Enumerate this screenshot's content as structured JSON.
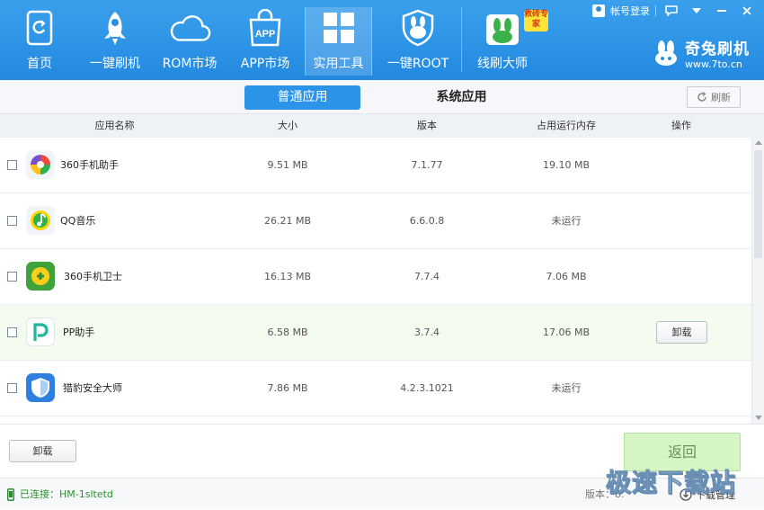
{
  "header": {
    "nav": [
      {
        "label": "首页",
        "icon": "home-icon"
      },
      {
        "label": "一键刷机",
        "icon": "rocket-icon"
      },
      {
        "label": "ROM市场",
        "icon": "cloud-icon"
      },
      {
        "label": "APP市场",
        "icon": "shopping-bag-icon",
        "icon_text": "APP"
      },
      {
        "label": "实用工具",
        "icon": "grid-icon"
      },
      {
        "label": "一键ROOT",
        "icon": "shield-rabbit-icon"
      },
      {
        "label": "线刷大师",
        "icon": "rabbit-master-icon"
      }
    ],
    "expert_badge": "救砖专家",
    "login_label": "帐号登录",
    "brand_name": "奇兔刷机",
    "brand_url": "www.7to.cn"
  },
  "tabs": [
    {
      "label": "普通应用",
      "active": true
    },
    {
      "label": "系统应用",
      "active": false
    }
  ],
  "refresh_label": "刷新",
  "table": {
    "columns": [
      "应用名称",
      "大小",
      "版本",
      "占用运行内存",
      "操作"
    ],
    "rows": [
      {
        "name": "360手机助手",
        "size": "9.51 MB",
        "version": "7.1.77",
        "memory": "19.10 MB",
        "action": "",
        "icon": "360-assistant-icon"
      },
      {
        "name": "QQ音乐",
        "size": "26.21 MB",
        "version": "6.6.0.8",
        "memory": "未运行",
        "action": "",
        "icon": "qq-music-icon"
      },
      {
        "name": "360手机卫士",
        "size": "16.13 MB",
        "version": "7.7.4",
        "memory": "7.06 MB",
        "action": "",
        "icon": "360-security-icon"
      },
      {
        "name": "PP助手",
        "size": "6.58 MB",
        "version": "3.7.4",
        "memory": "17.06 MB",
        "action": "卸载",
        "icon": "pp-assistant-icon"
      },
      {
        "name": "猎豹安全大师",
        "size": "7.86 MB",
        "version": "4.2.3.1021",
        "memory": "未运行",
        "action": "",
        "icon": "cheetah-security-icon"
      }
    ]
  },
  "uninstall_label": "卸载",
  "back_label": "返回",
  "status": {
    "connected": "已连接：HM-1sltetd",
    "version": "版本：8.",
    "download_manager": "下载管理"
  },
  "watermark": "极速下载站",
  "colors": {
    "header": "#2a8fe4",
    "accent": "#2c94e8",
    "connected": "#2b8f2e",
    "back_button": "#d6f5c4"
  }
}
